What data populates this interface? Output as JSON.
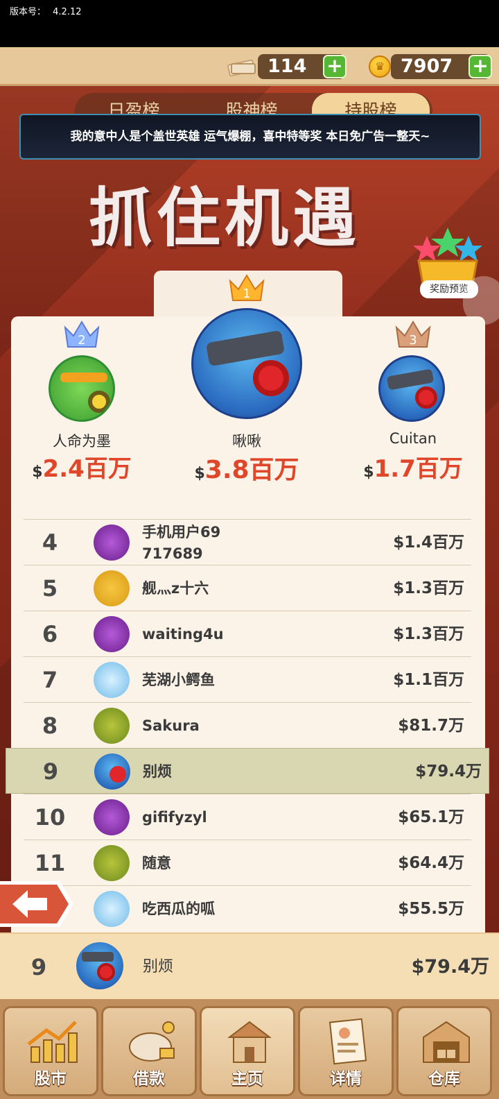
{
  "status_bar": {
    "version_label": "版本号：",
    "version": "4.2.12"
  },
  "currencies": {
    "cash": "114",
    "coins": "7907"
  },
  "tabs": [
    {
      "label": "日盈榜",
      "active": false
    },
    {
      "label": "股神榜",
      "active": false
    },
    {
      "label": "持股榜",
      "active": true
    }
  ],
  "marquee": "我的意中人是个盖世英雄 运气爆棚，喜中特等奖 本日免广告一整天~",
  "banner": {
    "title": "抓住机遇"
  },
  "reward_preview": "奖励预览",
  "podium": [
    {
      "rank": "2",
      "name": "人命为墨",
      "currency": "$",
      "value": "2.4百万",
      "avatar": "green-cannon"
    },
    {
      "rank": "1",
      "name": "啾啾",
      "currency": "$",
      "value": "3.8百万",
      "avatar": "blue-robot"
    },
    {
      "rank": "3",
      "name": "Cuitan",
      "currency": "$",
      "value": "1.7百万",
      "avatar": "blue-robot"
    }
  ],
  "ranking": [
    {
      "rank": "4",
      "name": "手机用户69\n717689",
      "value": "$1.4百万",
      "avatar": "purple"
    },
    {
      "rank": "5",
      "name": "舰灬z十六",
      "value": "$1.3百万",
      "avatar": "yellow"
    },
    {
      "rank": "6",
      "name": "waiting4u",
      "value": "$1.3百万",
      "avatar": "purple"
    },
    {
      "rank": "7",
      "name": "芜湖小鳄鱼",
      "value": "$1.1百万",
      "avatar": "white"
    },
    {
      "rank": "8",
      "name": "Sakura",
      "value": "$81.7万",
      "avatar": "olive"
    },
    {
      "rank": "9",
      "name": "别烦",
      "value": "$79.4万",
      "avatar": "robot",
      "highlight": true
    },
    {
      "rank": "10",
      "name": "gififyzyl",
      "value": "$65.1万",
      "avatar": "purple"
    },
    {
      "rank": "11",
      "name": "随意",
      "value": "$64.4万",
      "avatar": "olive"
    },
    {
      "rank": "",
      "name": "吃西瓜的呱",
      "value": "$55.5万",
      "avatar": "white"
    }
  ],
  "my_rank": {
    "rank": "9",
    "name": "别烦",
    "value": "$79.4万"
  },
  "nav": [
    {
      "label": "股市",
      "icon": "stock-chart-icon"
    },
    {
      "label": "借款",
      "icon": "piggy-bank-icon"
    },
    {
      "label": "主页",
      "icon": "home-icon",
      "active": true
    },
    {
      "label": "详情",
      "icon": "profile-doc-icon"
    },
    {
      "label": "仓库",
      "icon": "warehouse-icon"
    }
  ],
  "colors": {
    "accent_red": "#e0472a",
    "highlight_row": "#d9d7b1",
    "plus_green": "#55b734"
  }
}
